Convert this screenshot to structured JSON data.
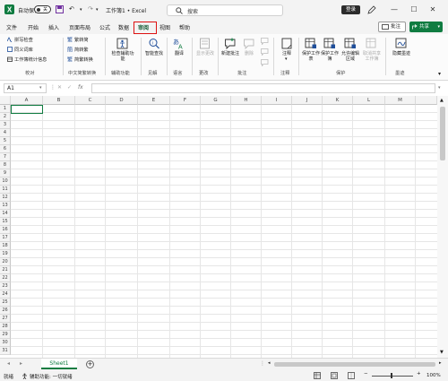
{
  "titlebar": {
    "autosave_label": "自动保存",
    "autosave_state": "关",
    "doc_title": "工作簿1 • Excel",
    "search_placeholder": "搜索",
    "login_label": "登录",
    "minimize": "—",
    "maximize": "☐",
    "close": "✕"
  },
  "tabs": [
    "文件",
    "开始",
    "插入",
    "页面布局",
    "公式",
    "数据",
    "审阅",
    "视图",
    "帮助"
  ],
  "active_tab": "审阅",
  "comment_button": "批注",
  "share_button": "共享",
  "ribbon": {
    "proofing": {
      "items": [
        "拼写检查",
        "同义词库",
        "工作簿统计信息"
      ],
      "label": "校对"
    },
    "chinese": {
      "items": [
        "繁转简",
        "简转繁",
        "简繁转换"
      ],
      "label": "中文简繁转换"
    },
    "accessibility": {
      "button": "检查辅助功能",
      "label": "辅助功能"
    },
    "insights": {
      "button": "智能查找",
      "label": "见解"
    },
    "language": {
      "button": "翻译",
      "label": "语言"
    },
    "changes": {
      "button": "显示更改",
      "label": "更改"
    },
    "comments": {
      "buttons": [
        "新建批注",
        "删除",
        "上一条",
        "下一条"
      ],
      "label": "批注"
    },
    "notes": {
      "button": "注释",
      "label": "注释"
    },
    "protect": {
      "buttons": [
        "保护工作表",
        "保护工作簿",
        "允许编辑区域",
        "取消共享工作簿"
      ],
      "label": "保护"
    },
    "ink": {
      "button": "隐藏墨迹",
      "label": "墨迹"
    }
  },
  "formula_bar": {
    "name_box": "A1",
    "fx": "fx",
    "value": ""
  },
  "grid": {
    "columns": [
      "A",
      "B",
      "C",
      "D",
      "E",
      "F",
      "G",
      "H",
      "I",
      "J",
      "K",
      "L",
      "M"
    ],
    "rows": [
      "1",
      "2",
      "3",
      "4",
      "5",
      "6",
      "7",
      "8",
      "9",
      "10",
      "11",
      "12",
      "13",
      "14",
      "15",
      "16",
      "17",
      "18",
      "19",
      "20",
      "21",
      "22",
      "23",
      "24",
      "25",
      "26",
      "27",
      "28",
      "29",
      "30",
      "31"
    ],
    "selected": "A1"
  },
  "sheets": [
    "Sheet1"
  ],
  "status": {
    "ready": "就绪",
    "accessibility": "辅助功能: 一切就绪",
    "zoom": "100%"
  },
  "colors": {
    "accent": "#107c41",
    "highlight": "#dd1111"
  }
}
